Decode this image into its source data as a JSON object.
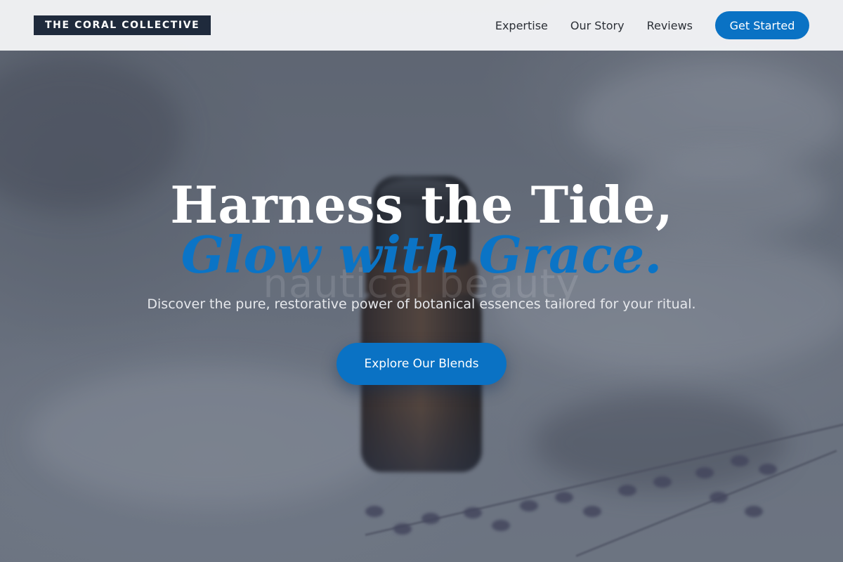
{
  "header": {
    "brand": "THE CORAL COLLECTIVE",
    "nav": [
      {
        "label": "Expertise"
      },
      {
        "label": "Our Story"
      },
      {
        "label": "Reviews"
      }
    ],
    "cta_label": "Get Started"
  },
  "hero": {
    "headline": "Harness the Tide,",
    "subheadline": "Glow with Grace.",
    "ghost_text": "nautical beauty",
    "tagline": "Discover the pure, restorative power of botanical essences tailored for your ritual.",
    "cta_label": "Explore Our Blends",
    "background_image": "essential-oil-bottle-with-lavender"
  },
  "colors": {
    "accent": "#0a72c4",
    "brand_bg": "#1f2a3c",
    "header_bg": "#f2f3f5"
  }
}
